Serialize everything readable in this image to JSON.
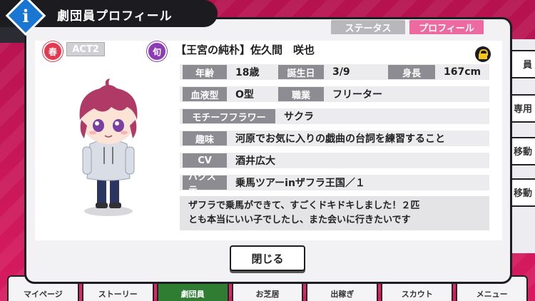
{
  "dialog": {
    "title": "劇団員プロフィール",
    "info_glyph": "i",
    "tabs": {
      "status": "ステータス",
      "profile": "プロフィール"
    },
    "close_label": "閉じる"
  },
  "badges": {
    "season": "春",
    "act": "ACT2",
    "shun": "旬"
  },
  "character": {
    "name": "【王宮の純朴】佐久間　咲也",
    "age_label": "年齢",
    "age": "18歳",
    "birthday_label": "誕生日",
    "birthday": "3/9",
    "height_label": "身長",
    "height": "167cm",
    "blood_label": "血液型",
    "blood": "O型",
    "job_label": "職業",
    "job": "フリーター",
    "flower_label": "モチーフフラワー",
    "flower": "サクラ",
    "hobby_label": "趣味",
    "hobby": "河原でお気に入りの戯曲の台詞を練習すること",
    "cv_label": "CV",
    "cv": "酒井広大",
    "backstage_label": "バクステ",
    "backstage": "乗馬ツアーinザフラ王国／１",
    "comment_line1": "ザフラで乗馬ができて、すごくドキドキしました！２匹",
    "comment_line2": "とも本当にいい子でしたし、また会いに行きたいです"
  },
  "side_menu": [
    "員",
    "専用",
    "移動",
    "移動"
  ],
  "bottom_nav": [
    "マイページ",
    "ストーリー",
    "劇団員",
    "お芝居",
    "出稼ぎ",
    "スカウト",
    "メニュー"
  ],
  "colors": {
    "accent_pink": "#ec6aa0",
    "label_gray": "#8c8c92",
    "info_blue": "#1976d2"
  }
}
